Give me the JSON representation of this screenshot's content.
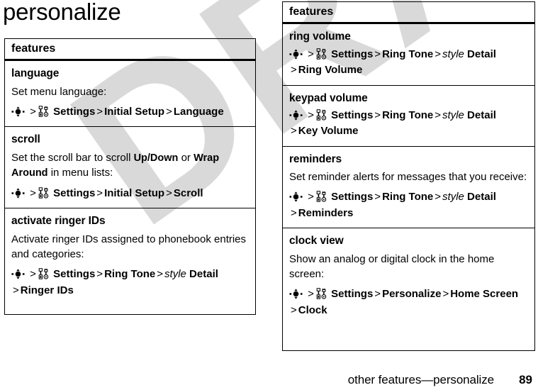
{
  "page": {
    "title": "personalize",
    "watermark": "DRAFT",
    "footer_text": "other features—personalize",
    "footer_page": "89"
  },
  "icons": {
    "nav_key": "joystick-nav-key-icon",
    "settings": "settings-tools-icon"
  },
  "colors": {
    "text": "#000000",
    "watermark": "#d9d9d9",
    "border": "#000000",
    "background": "#ffffff"
  },
  "left_table": {
    "header": "features",
    "rows": [
      {
        "title": "language",
        "desc_pre": "Set menu language:",
        "path_line1": [
          {
            "t": "icon",
            "v": "nav_key"
          },
          {
            "t": "sep",
            "v": ">"
          },
          {
            "t": "icon",
            "v": "settings"
          },
          {
            "t": "b",
            "v": "Settings"
          },
          {
            "t": "sep",
            "v": ">"
          },
          {
            "t": "b",
            "v": "Initial Setup"
          },
          {
            "t": "sep",
            "v": ">"
          },
          {
            "t": "b",
            "v": "Language"
          }
        ]
      },
      {
        "title": "scroll",
        "desc_parts": [
          {
            "t": "n",
            "v": "Set the scroll bar to scroll "
          },
          {
            "t": "b",
            "v": "Up/Down"
          },
          {
            "t": "n",
            "v": " or "
          },
          {
            "t": "b",
            "v": "Wrap Around"
          },
          {
            "t": "n",
            "v": " in menu lists:"
          }
        ],
        "path_line1": [
          {
            "t": "icon",
            "v": "nav_key"
          },
          {
            "t": "sep",
            "v": ">"
          },
          {
            "t": "icon",
            "v": "settings"
          },
          {
            "t": "b",
            "v": "Settings"
          },
          {
            "t": "sep",
            "v": ">"
          },
          {
            "t": "b",
            "v": "Initial Setup"
          },
          {
            "t": "sep",
            "v": ">"
          },
          {
            "t": "b",
            "v": "Scroll"
          }
        ]
      },
      {
        "title": "activate ringer IDs",
        "desc_pre": "Activate ringer IDs assigned to phonebook entries and categories:",
        "path_line1": [
          {
            "t": "icon",
            "v": "nav_key"
          },
          {
            "t": "sep",
            "v": ">"
          },
          {
            "t": "icon",
            "v": "settings"
          },
          {
            "t": "b",
            "v": "Settings"
          },
          {
            "t": "sep",
            "v": ">"
          },
          {
            "t": "b",
            "v": "Ring Tone"
          },
          {
            "t": "sep",
            "v": ">"
          },
          {
            "t": "i",
            "v": "style"
          },
          {
            "t": "b",
            "v": " Detail"
          },
          {
            "t": "br",
            "v": ""
          },
          {
            "t": "sep",
            "v": ">"
          },
          {
            "t": "b",
            "v": "Ringer IDs"
          }
        ]
      }
    ]
  },
  "right_table": {
    "header": "features",
    "rows": [
      {
        "title": "ring volume",
        "desc_pre": "",
        "path_line1": [
          {
            "t": "icon",
            "v": "nav_key"
          },
          {
            "t": "sep",
            "v": ">"
          },
          {
            "t": "icon",
            "v": "settings"
          },
          {
            "t": "b",
            "v": "Settings"
          },
          {
            "t": "sep",
            "v": ">"
          },
          {
            "t": "b",
            "v": "Ring Tone"
          },
          {
            "t": "sep",
            "v": ">"
          },
          {
            "t": "i",
            "v": "style"
          },
          {
            "t": "b",
            "v": " Detail"
          },
          {
            "t": "br",
            "v": ""
          },
          {
            "t": "sep",
            "v": ">"
          },
          {
            "t": "b",
            "v": "Ring Volume"
          }
        ]
      },
      {
        "title": "keypad volume",
        "desc_pre": "",
        "path_line1": [
          {
            "t": "icon",
            "v": "nav_key"
          },
          {
            "t": "sep",
            "v": ">"
          },
          {
            "t": "icon",
            "v": "settings"
          },
          {
            "t": "b",
            "v": "Settings"
          },
          {
            "t": "sep",
            "v": ">"
          },
          {
            "t": "b",
            "v": "Ring Tone"
          },
          {
            "t": "sep",
            "v": ">"
          },
          {
            "t": "i",
            "v": "style"
          },
          {
            "t": "b",
            "v": " Detail"
          },
          {
            "t": "br",
            "v": ""
          },
          {
            "t": "sep",
            "v": ">"
          },
          {
            "t": "b",
            "v": "Key Volume"
          }
        ]
      },
      {
        "title": "reminders",
        "desc_pre": "Set reminder alerts for messages that you receive:",
        "path_line1": [
          {
            "t": "icon",
            "v": "nav_key"
          },
          {
            "t": "sep",
            "v": ">"
          },
          {
            "t": "icon",
            "v": "settings"
          },
          {
            "t": "b",
            "v": "Settings"
          },
          {
            "t": "sep",
            "v": ">"
          },
          {
            "t": "b",
            "v": "Ring Tone"
          },
          {
            "t": "sep",
            "v": ">"
          },
          {
            "t": "i",
            "v": "style"
          },
          {
            "t": "b",
            "v": " Detail"
          },
          {
            "t": "br",
            "v": ""
          },
          {
            "t": "sep",
            "v": ">"
          },
          {
            "t": "b",
            "v": "Reminders"
          }
        ]
      },
      {
        "title": "clock view",
        "desc_pre": "Show an analog or digital clock in the home screen:",
        "path_line1": [
          {
            "t": "icon",
            "v": "nav_key"
          },
          {
            "t": "sep",
            "v": ">"
          },
          {
            "t": "icon",
            "v": "settings"
          },
          {
            "t": "b",
            "v": "Settings"
          },
          {
            "t": "sep",
            "v": ">"
          },
          {
            "t": "b",
            "v": "Personalize"
          },
          {
            "t": "sep",
            "v": ">"
          },
          {
            "t": "b",
            "v": "Home Screen"
          },
          {
            "t": "br",
            "v": ""
          },
          {
            "t": "sep",
            "v": ">"
          },
          {
            "t": "b",
            "v": "Clock"
          }
        ]
      }
    ]
  }
}
